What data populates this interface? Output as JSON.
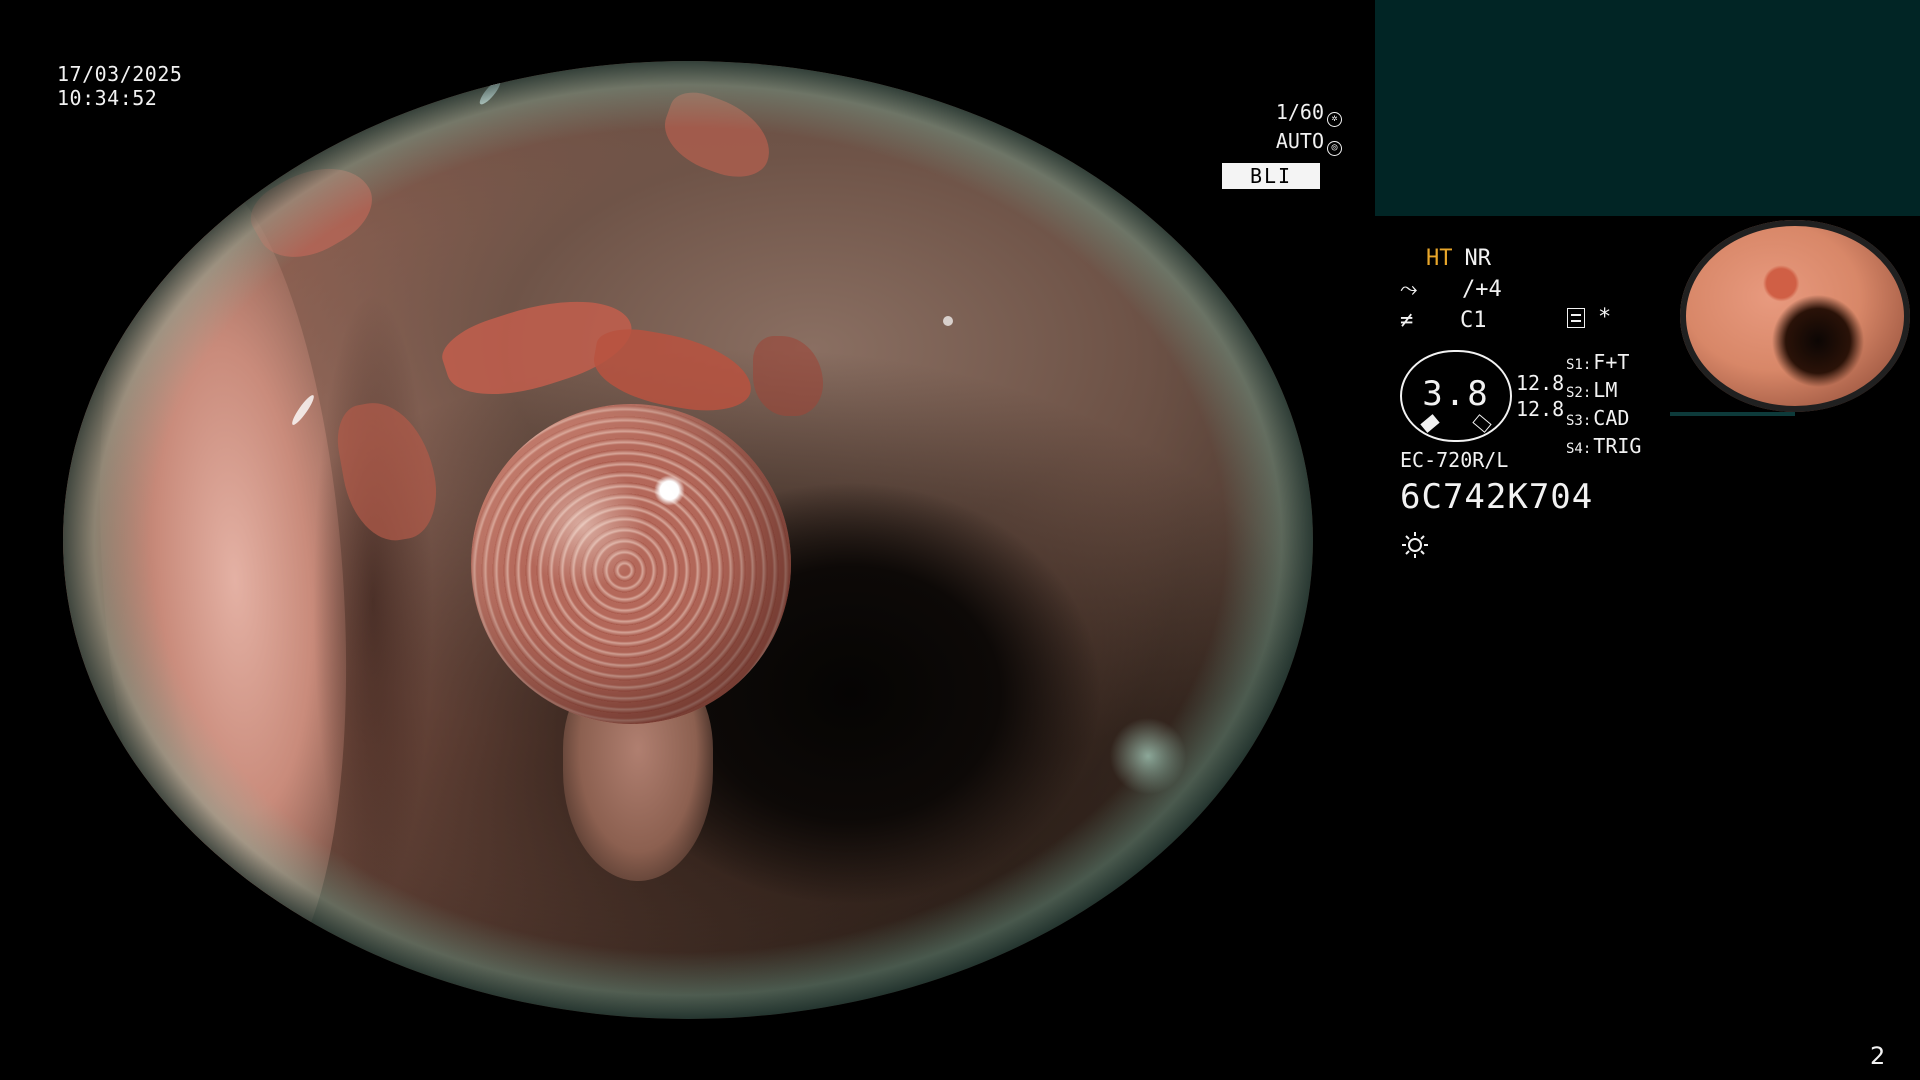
{
  "overlay": {
    "date": "17/03/2025",
    "time": "10:34:52"
  },
  "exposure": {
    "shutter": "1/60",
    "shutter_icon": "shutter-icon",
    "mode": "AUTO",
    "mode_icon": "auto-iris-icon",
    "light_mode": "BLI"
  },
  "status": {
    "ht": "HT",
    "nr": "NR",
    "enhancement": "/+4",
    "color": "C1",
    "enhancement_icon": "structure-enhance-icon",
    "color_icon": "color-mode-icon",
    "memo_icon": "memo-icon",
    "asterisk": "*"
  },
  "gauge": {
    "value": "3.8",
    "left": "12.8",
    "right": "12.8"
  },
  "scope_switches": [
    {
      "key": "S1:",
      "value": "F+T"
    },
    {
      "key": "S2:",
      "value": "LM"
    },
    {
      "key": "S3:",
      "value": "CAD"
    },
    {
      "key": "S4:",
      "value": "TRIG"
    }
  ],
  "device": {
    "model": "EC-720R/L",
    "serial": "6C742K704",
    "light_icon": "light-source-icon"
  },
  "colors": {
    "highlight": "#e8a62a",
    "panel": "#012525",
    "text": "#f2f2f2"
  },
  "page_number": "2"
}
